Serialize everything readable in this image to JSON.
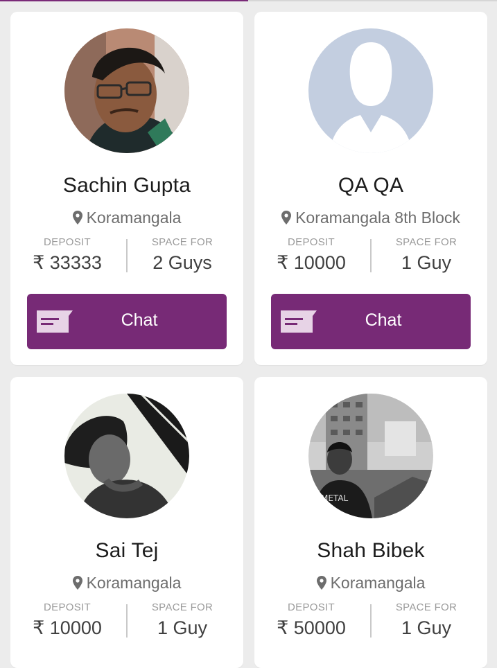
{
  "colors": {
    "accent": "#772a76",
    "background": "#ececec"
  },
  "cards": [
    {
      "name": "Sachin Gupta",
      "location": "Koramangala",
      "deposit_label": "DEPOSIT",
      "deposit_value": "₹ 33333",
      "space_label": "SPACE FOR",
      "space_value": "2 Guys",
      "chat_label": "Chat"
    },
    {
      "name": "QA QA",
      "location": "Koramangala 8th Block",
      "deposit_label": "DEPOSIT",
      "deposit_value": "₹ 10000",
      "space_label": "SPACE FOR",
      "space_value": "1 Guy",
      "chat_label": "Chat"
    },
    {
      "name": "Sai Tej",
      "location": "Koramangala",
      "deposit_label": "DEPOSIT",
      "deposit_value": "₹ 10000",
      "space_label": "SPACE FOR",
      "space_value": "1 Guy"
    },
    {
      "name": "Shah Bibek",
      "location": "Koramangala",
      "deposit_label": "DEPOSIT",
      "deposit_value": "₹ 50000",
      "space_label": "SPACE FOR",
      "space_value": "1 Guy"
    }
  ]
}
